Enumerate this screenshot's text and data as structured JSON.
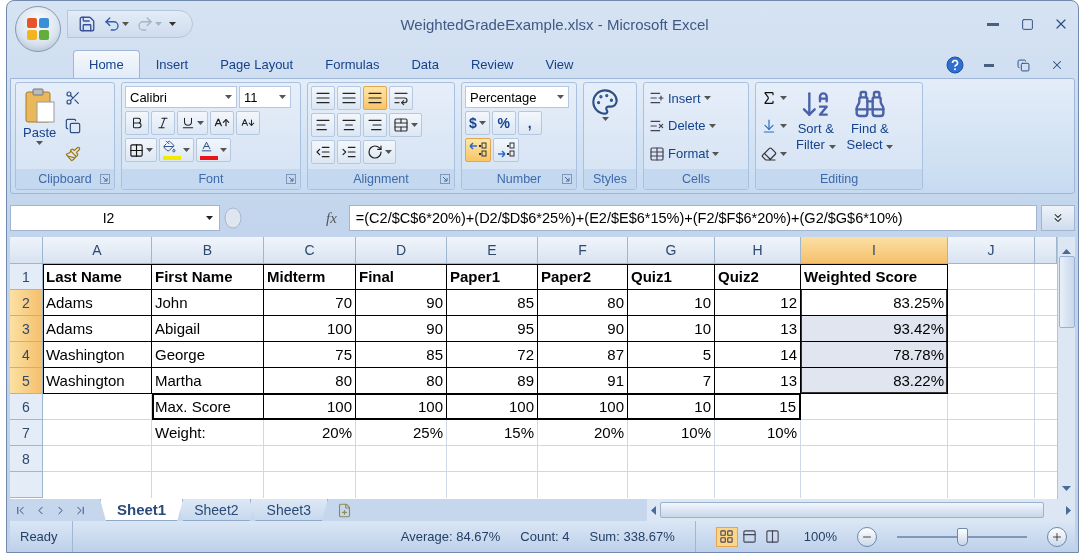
{
  "window": {
    "title": "WeightedGradeExample.xlsx - Microsoft Excel"
  },
  "tabs": [
    {
      "label": "Home",
      "selected": true
    },
    {
      "label": "Insert",
      "selected": false
    },
    {
      "label": "Page Layout",
      "selected": false
    },
    {
      "label": "Formulas",
      "selected": false
    },
    {
      "label": "Data",
      "selected": false
    },
    {
      "label": "Review",
      "selected": false
    },
    {
      "label": "View",
      "selected": false
    }
  ],
  "ribbon": {
    "clipboard": {
      "title": "Clipboard",
      "paste": "Paste"
    },
    "font": {
      "title": "Font",
      "font_name": "Calibri",
      "font_size": "11"
    },
    "alignment": {
      "title": "Alignment",
      "vertical": [
        {
          "selected": false
        },
        {
          "selected": false
        },
        {
          "selected": true
        }
      ]
    },
    "number": {
      "title": "Number",
      "format": "Percentage",
      "symbols": [
        "$",
        "%",
        ","
      ],
      "decimals": [
        {
          "selected": true
        },
        {
          "selected": false
        }
      ]
    },
    "styles": {
      "title": "Styles"
    },
    "cells": {
      "title": "Cells",
      "buttons": [
        "Insert",
        "Delete",
        "Format"
      ]
    },
    "editing": {
      "title": "Editing",
      "sort": [
        "Sort &",
        "Filter"
      ],
      "find": [
        "Find &",
        "Select"
      ]
    }
  },
  "formula_bar": {
    "name_box": "I2",
    "function_label": "fx",
    "formula": "=(C2/$C$6*20%)+(D2/$D$6*25%)+(E2/$E$6*15%)+(F2/$F$6*20%)+(G2/$G$6*10%)"
  },
  "sheet": {
    "columns": [
      {
        "label": "A",
        "selected": false
      },
      {
        "label": "B",
        "selected": false
      },
      {
        "label": "C",
        "selected": false
      },
      {
        "label": "D",
        "selected": false
      },
      {
        "label": "E",
        "selected": false
      },
      {
        "label": "F",
        "selected": false
      },
      {
        "label": "G",
        "selected": false
      },
      {
        "label": "H",
        "selected": false
      },
      {
        "label": "I",
        "selected": true
      },
      {
        "label": "J",
        "selected": false
      }
    ],
    "rows": [
      {
        "number": "1",
        "selected": false,
        "kind": "heading",
        "cells": [
          "Last Name",
          "First Name",
          "Midterm",
          "Final",
          "Paper1",
          "Paper2",
          "Quiz1",
          "Quiz2",
          "Weighted Score",
          null
        ]
      },
      {
        "number": "2",
        "selected": true,
        "kind": "bordered",
        "cells": [
          "Adams",
          "John",
          "70",
          "90",
          "85",
          "80",
          "10",
          "12",
          "83.25%",
          null
        ]
      },
      {
        "number": "3",
        "selected": true,
        "kind": "bordered",
        "cells": [
          "Adams",
          "Abigail",
          "100",
          "90",
          "95",
          "90",
          "10",
          "13",
          "93.42%",
          null
        ]
      },
      {
        "number": "4",
        "selected": true,
        "kind": "bordered",
        "cells": [
          "Washington",
          "George",
          "75",
          "85",
          "72",
          "87",
          "5",
          "14",
          "78.78%",
          null
        ]
      },
      {
        "number": "5",
        "selected": true,
        "kind": "bordered",
        "cells": [
          "Washington",
          "Martha",
          "80",
          "80",
          "89",
          "91",
          "7",
          "13",
          "83.22%",
          null
        ]
      },
      {
        "number": "6",
        "selected": false,
        "kind": "boxed",
        "cells": [
          null,
          "Max. Score",
          "100",
          "100",
          "100",
          "100",
          "10",
          "15",
          null,
          null
        ]
      },
      {
        "number": "7",
        "selected": false,
        "kind": "plain",
        "cells": [
          null,
          "Weight:",
          "20%",
          "25%",
          "15%",
          "20%",
          "10%",
          "10%",
          null,
          null
        ]
      },
      {
        "number": "8",
        "selected": false,
        "kind": "plain",
        "cells": [
          null,
          null,
          null,
          null,
          null,
          null,
          null,
          null,
          null,
          null
        ]
      }
    ]
  },
  "sheet_tabs": [
    {
      "label": "Sheet1",
      "selected": true
    },
    {
      "label": "Sheet2",
      "selected": false
    },
    {
      "label": "Sheet3",
      "selected": false
    }
  ],
  "status_bar": {
    "mode": "Ready",
    "average": "Average: 84.67%",
    "count": "Count: 4",
    "sum": "Sum: 338.67%",
    "views": [
      {
        "selected": true
      },
      {
        "selected": false
      },
      {
        "selected": false
      }
    ],
    "zoom": "100%",
    "zoom_slider": {
      "level": 0.5
    }
  }
}
